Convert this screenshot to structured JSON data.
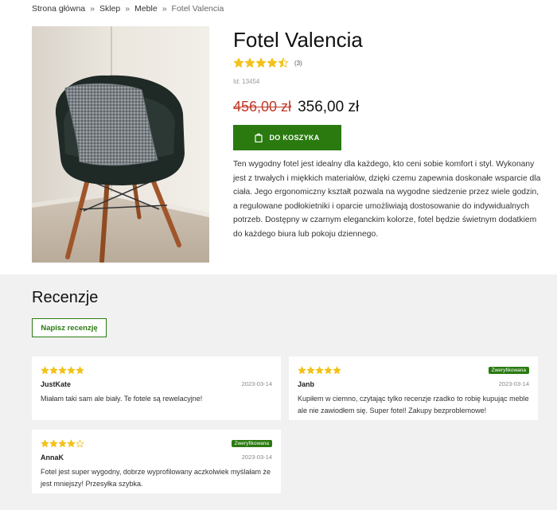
{
  "breadcrumb": {
    "items": [
      "Strona główna",
      "Sklep",
      "Meble"
    ],
    "current": "Fotel Valencia",
    "separator": "»"
  },
  "product": {
    "title": "Fotel Valencia",
    "rating": 4.5,
    "rating_max": 5,
    "rating_count": "(3)",
    "id_label": "Id: 13454",
    "old_price": "456,00 zł",
    "new_price": "356,00 zł",
    "cart_button": "DO KOSZYKA",
    "description": "Ten wygodny fotel jest idealny dla każdego, kto ceni sobie komfort i styl. Wykonany jest z trwałych i miękkich materiałów, dzięki czemu zapewnia doskonałe wsparcie dla ciała. Jego ergonomiczny kształt pozwala na wygodne siedzenie przez wiele godzin, a regulowane podłokietniki i oparcie umożliwiają dostosowanie do indywidualnych potrzeb. Dostępny w czarnym eleganckim kolorze, fotel będzie świetnym dodatkiem do każdego biura lub pokoju dziennego."
  },
  "reviews": {
    "title": "Recenzje",
    "write_button": "Napisz recenzję",
    "items": [
      {
        "author": "JustKate",
        "date": "2023-03-14",
        "rating": 5,
        "verified": "",
        "text": "Miałam taki sam ale biały. Te fotele są rewelacyjne!"
      },
      {
        "author": "Janb",
        "date": "2023-03-14",
        "rating": 5,
        "verified": "Zweryfikowana",
        "text": "Kupiłem w ciemno, czytając tylko recenzje rzadko to robię kupując meble ale nie zawiodłem się. Super fotel! Zakupy bezproblemowe!"
      },
      {
        "author": "AnnaK",
        "date": "2023-03-14",
        "rating": 4,
        "verified": "Zweryfikowana",
        "text": "Fotel jest super wygodny, dobrze wyprofilowany aczkolwiek myślałam że jest mniejszy! Przesyłka szybka."
      }
    ]
  },
  "colors": {
    "accent": "#2a7a10",
    "star": "#f2c21a",
    "old_price": "#c0392b",
    "reviews_bg": "#f1f1f1"
  }
}
